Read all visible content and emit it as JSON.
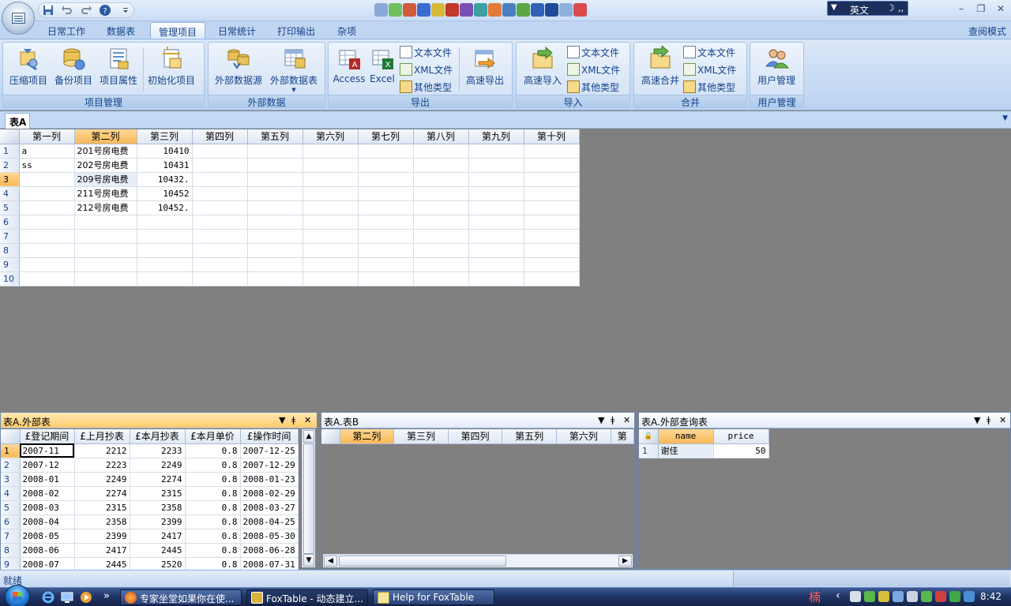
{
  "title_bar": {
    "ime_language": "英文",
    "ime_arrow": "▼",
    "ime_moon": "☽ ‚‚",
    "minimize": "–",
    "maximize": "❐",
    "close": "✕"
  },
  "ribbon_tabs": [
    "日常工作",
    "数据表",
    "管理项目",
    "日常统计",
    "打印输出",
    "杂项"
  ],
  "active_tab": "管理项目",
  "read_mode": "查阅模式",
  "groups": {
    "project": {
      "label": "项目管理",
      "buttons": [
        "压缩项目",
        "备份项目",
        "项目属性",
        "初始化项目"
      ]
    },
    "external_data": {
      "label": "外部数据",
      "buttons": [
        "外部数据源",
        "外部数据表"
      ]
    },
    "export": {
      "label": "导出",
      "big": [
        "Access",
        "Excel"
      ],
      "small": [
        "文本文件",
        "XML文件",
        "其他类型"
      ],
      "fast": "高速导出"
    },
    "import": {
      "label": "导入",
      "big": "高速导入",
      "small": [
        "文本文件",
        "XML文件",
        "其他类型"
      ]
    },
    "merge": {
      "label": "合并",
      "big": "高速合并",
      "small": [
        "文本文件",
        "XML文件",
        "其他类型"
      ]
    },
    "users": {
      "label": "用户管理",
      "big": "用户管理"
    }
  },
  "doc_tab": "表A",
  "main_table": {
    "columns": [
      "第一列",
      "第二列",
      "第三列",
      "第四列",
      "第五列",
      "第六列",
      "第七列",
      "第八列",
      "第九列",
      "第十列"
    ],
    "rows": [
      [
        "1",
        "a",
        "201号房电费",
        "10410"
      ],
      [
        "2",
        "ss",
        "202号房电费",
        "10431"
      ],
      [
        "3",
        "",
        "209号房电费",
        "10432."
      ],
      [
        "4",
        "",
        "211号房电费",
        "10452"
      ],
      [
        "5",
        "",
        "212号房电费",
        "10452."
      ],
      [
        "6",
        "",
        "",
        ""
      ],
      [
        "7",
        "",
        "",
        ""
      ],
      [
        "8",
        "",
        "",
        ""
      ],
      [
        "9",
        "",
        "",
        ""
      ],
      [
        "10",
        "",
        "",
        ""
      ]
    ]
  },
  "pane_external": {
    "title": "表A.外部表",
    "columns": [
      "£登记期间",
      "£上月抄表",
      "£本月抄表",
      "£本月单价",
      "£操作时间"
    ],
    "rows": [
      [
        "1",
        "2007-11",
        "2212",
        "2233",
        "0.8",
        "2007-12-25"
      ],
      [
        "2",
        "2007-12",
        "2223",
        "2249",
        "0.8",
        "2007-12-29"
      ],
      [
        "3",
        "2008-01",
        "2249",
        "2274",
        "0.8",
        "2008-01-23"
      ],
      [
        "4",
        "2008-02",
        "2274",
        "2315",
        "0.8",
        "2008-02-29"
      ],
      [
        "5",
        "2008-03",
        "2315",
        "2358",
        "0.8",
        "2008-03-27"
      ],
      [
        "6",
        "2008-04",
        "2358",
        "2399",
        "0.8",
        "2008-04-25"
      ],
      [
        "7",
        "2008-05",
        "2399",
        "2417",
        "0.8",
        "2008-05-30"
      ],
      [
        "8",
        "2008-06",
        "2417",
        "2445",
        "0.8",
        "2008-06-28"
      ],
      [
        "9",
        "2008-07",
        "2445",
        "2520",
        "0.8",
        "2008-07-31"
      ]
    ]
  },
  "pane_b": {
    "title": "表A.表B",
    "columns": [
      "第二列",
      "第三列",
      "第四列",
      "第五列",
      "第六列",
      "第"
    ]
  },
  "pane_query": {
    "title": "表A.外部查询表",
    "columns": [
      "name",
      "price"
    ],
    "rows": [
      [
        "1",
        "谢佳",
        "50"
      ]
    ]
  },
  "pane_controls": {
    "dropdown": "▼",
    "pin": "ǂ",
    "close": "✕"
  },
  "status": {
    "text": "就绪"
  },
  "taskbar": {
    "tasks": [
      "专家坐堂如果你在使...",
      "FoxTable - 动态建立...",
      "Help for FoxTable"
    ],
    "more": "»",
    "clock": "8:42",
    "ime_tray": "楠",
    "tray_arrow": "‹"
  },
  "colors": {
    "ribbon_text": "#15428b",
    "selected_header": "#f8b859",
    "workspace": "#808080"
  }
}
